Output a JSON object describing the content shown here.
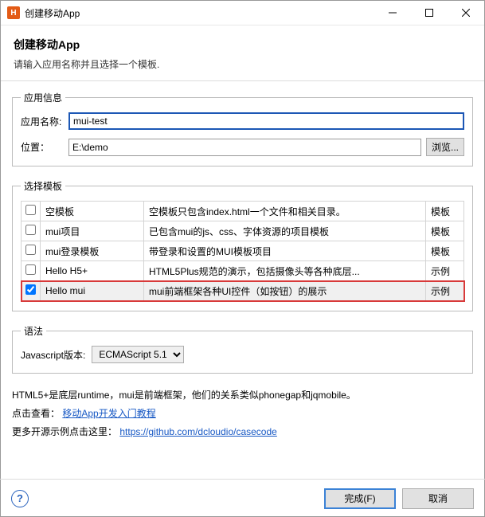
{
  "window": {
    "icon_letter": "H",
    "title": "创建移动App"
  },
  "header": {
    "title": "创建移动App",
    "subtitle": "请输入应用名称并且选择一个模板."
  },
  "appinfo": {
    "legend": "应用信息",
    "name_label": "应用名称:",
    "name_value": "mui-test",
    "location_label": "位置：",
    "location_value": "E:\\demo",
    "browse_label": "浏览..."
  },
  "templates": {
    "legend": "选择模板",
    "rows": [
      {
        "checked": false,
        "name": "空模板",
        "desc": "空模板只包含index.html一个文件和相关目录。",
        "kind": "模板"
      },
      {
        "checked": false,
        "name": "mui项目",
        "desc": "已包含mui的js、css、字体资源的项目模板",
        "kind": "模板"
      },
      {
        "checked": false,
        "name": "mui登录模板",
        "desc": "带登录和设置的MUI模板项目",
        "kind": "模板"
      },
      {
        "checked": false,
        "name": "Hello H5+",
        "desc": "HTML5Plus规范的演示，包括摄像头等各种底层...",
        "kind": "示例"
      },
      {
        "checked": true,
        "name": "Hello mui",
        "desc": "mui前端框架各种UI控件（如按钮）的展示",
        "kind": "示例"
      }
    ]
  },
  "syntax": {
    "legend": "语法",
    "js_label": "Javascript版本:",
    "js_value": "ECMAScript 5.1"
  },
  "bottom": {
    "line1": "HTML5+是底层runtime，mui是前端框架，他们的关系类似phonegap和jqmobile。",
    "line2_prefix": "点击查看：",
    "line2_link": "移动App开发入门教程",
    "line3_prefix": "更多开源示例点击这里：",
    "line3_link": "https://github.com/dcloudio/casecode"
  },
  "footer": {
    "help": "?",
    "finish": "完成(F)",
    "cancel": "取消"
  }
}
